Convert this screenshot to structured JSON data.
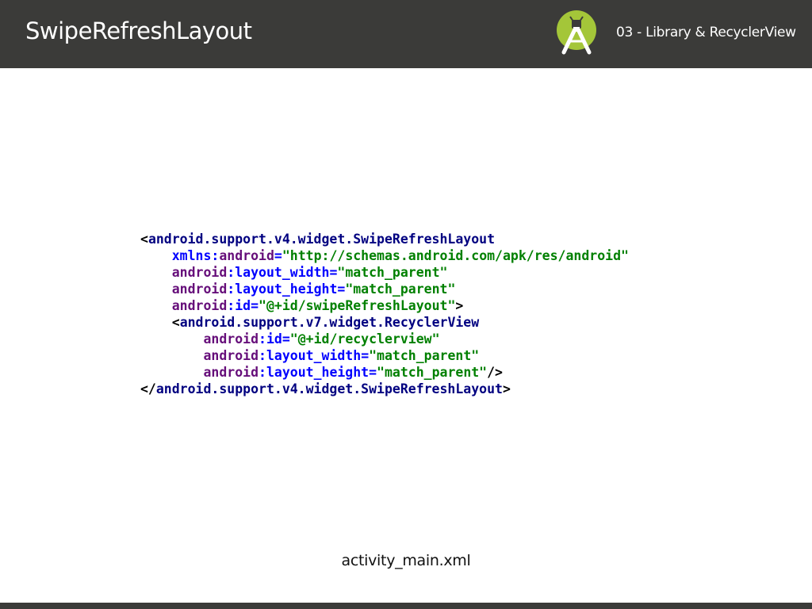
{
  "header": {
    "title": "SwipeRefreshLayout",
    "section": "03 - Library & RecyclerView",
    "logo_icon": "android-studio-icon"
  },
  "code": {
    "l1_tag": "android.support.v4.widget.SwipeRefreshLayout",
    "l2_ns": "xmlns:",
    "l2_attr": "android",
    "l2_val": "\"http://schemas.android.com/apk/res/android\"",
    "l3_attr": "layout_width",
    "l3_val": "\"match_parent\"",
    "l4_attr": "layout_height",
    "l4_val": "\"match_parent\"",
    "l5_attr": "id",
    "l5_val": "\"@+id/swipeRefreshLayout\"",
    "l6_tag": "android.support.v7.widget.RecyclerView",
    "l7_attr": "id",
    "l7_val": "\"@+id/recyclerview\"",
    "l8_attr": "layout_width",
    "l8_val": "\"match_parent\"",
    "l9_attr": "layout_height",
    "l9_val": "\"match_parent\"",
    "l10_tag": "android.support.v4.widget.SwipeRefreshLayout",
    "ns_prefix": "android"
  },
  "filename": "activity_main.xml",
  "colors": {
    "header_bg": "#3b3b39",
    "logo_green": "#a4c639",
    "tag": "#000080",
    "attribute": "#660e7a",
    "namespace": "#0000ff",
    "value": "#008000"
  }
}
